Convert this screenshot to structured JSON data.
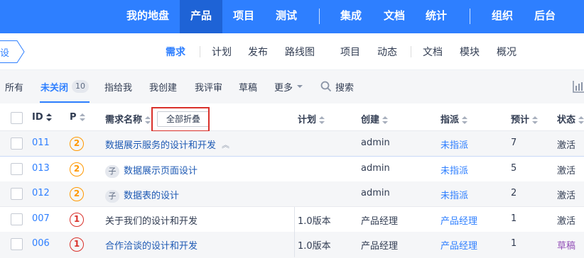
{
  "topnav": {
    "items": [
      "我的地盘",
      "产品",
      "项目",
      "测试",
      "集成",
      "文档",
      "统计",
      "组织",
      "后台"
    ],
    "active": "产品"
  },
  "subnav": {
    "breadcrumb": "设",
    "items": [
      "需求",
      "计划",
      "发布",
      "路线图",
      "项目",
      "动态",
      "文档",
      "模块",
      "概况"
    ],
    "active": "需求"
  },
  "filterbar": {
    "all": "所有",
    "unclosed": "未关闭",
    "unclosed_count": "10",
    "assigned_to_me": "指给我",
    "created_by_me": "我创建",
    "reviewed_by_me": "我评审",
    "draft": "草稿",
    "more": "更多",
    "search": "搜索"
  },
  "table": {
    "headers": {
      "id": "ID",
      "pri": "P",
      "name": "需求名称",
      "plan": "计划",
      "creator": "创建",
      "assigned": "指派",
      "estimate": "预计",
      "status": "状态"
    },
    "collapse_all": "全部折叠",
    "child_tag": "子",
    "rows": [
      {
        "id": "011",
        "pri": "2",
        "name": "数据展示服务的设计和开发",
        "child": false,
        "plan": "",
        "creator": "admin",
        "assigned": "未指派",
        "estimate": "7",
        "status": "激活"
      },
      {
        "id": "013",
        "pri": "2",
        "name": "数据展示页面设计",
        "child": true,
        "plan": "",
        "creator": "admin",
        "assigned": "未指派",
        "estimate": "5",
        "status": "激活"
      },
      {
        "id": "012",
        "pri": "2",
        "name": "数据表的设计",
        "child": true,
        "plan": "",
        "creator": "admin",
        "assigned": "未指派",
        "estimate": "2",
        "status": "激活"
      },
      {
        "id": "007",
        "pri": "1",
        "name": "关于我们的设计和开发",
        "child": false,
        "plan": "1.0版本",
        "creator": "产品经理",
        "assigned": "产品经理",
        "estimate": "1",
        "status": "激活"
      },
      {
        "id": "006",
        "pri": "1",
        "name": "合作洽谈的设计和开发",
        "child": false,
        "plan": "1.0版本",
        "creator": "产品经理",
        "assigned": "产品经理",
        "estimate": "1",
        "status": "草稿"
      }
    ]
  },
  "colors": {
    "brand": "#2e7fff",
    "highlight_box": "#d9312b",
    "pri1": "#d9312b",
    "pri2": "#ff9800",
    "draft": "#9553b8"
  }
}
